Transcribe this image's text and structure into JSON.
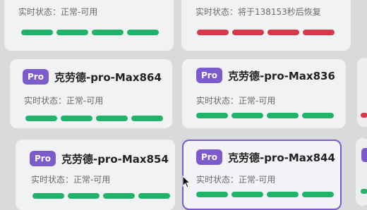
{
  "cards": [
    {
      "id": "top-left",
      "name": "",
      "status": "实时状态：正常-可用",
      "bars": [
        "green",
        "green",
        "green",
        "green"
      ]
    },
    {
      "id": "top-right",
      "name": "",
      "status": "实时状态：将于138153秒后恢复",
      "bars": [
        "red",
        "red",
        "red",
        "red"
      ]
    },
    {
      "id": "mid-left",
      "badge": "Pro",
      "name": "克劳德-pro-Max864",
      "status": "实时状态：正常-可用",
      "bars": [
        "green",
        "green",
        "green",
        "green"
      ]
    },
    {
      "id": "mid-right",
      "badge": "Pro",
      "name": "克劳德-pro-Max836",
      "status": "实时状态：正常-可用",
      "bars": [
        "green",
        "green",
        "green",
        "green"
      ]
    },
    {
      "id": "bot-left",
      "badge": "Pro",
      "name": "克劳德-pro-Max854",
      "status": "实时状态：正常-可用",
      "bars": [
        "green",
        "green",
        "green",
        "green"
      ]
    },
    {
      "id": "bot-right",
      "badge": "Pro",
      "name": "克劳德-pro-Max844",
      "status": "实时状态：正常-可用",
      "bars": [
        "green",
        "green",
        "green",
        "green"
      ],
      "selected": true
    }
  ],
  "colors": {
    "ok": "#22b36b",
    "down": "#d43a4c",
    "badge": "#7c5bcc",
    "selected_border": "#7b5bc8"
  }
}
